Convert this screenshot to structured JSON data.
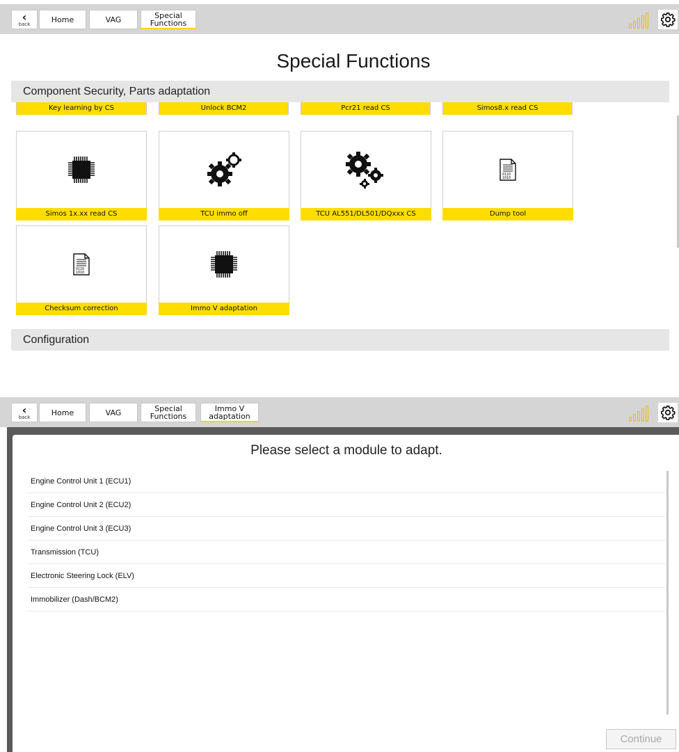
{
  "top": {
    "toolbar": {
      "back_label": "back",
      "crumbs": [
        "Home",
        "VAG",
        "Special Functions"
      ]
    },
    "title": "Special Functions",
    "section1": "Component Security, Parts adaptation",
    "strip_labels": [
      "Key learning by CS",
      "Unlock BCM2",
      "Pcr21 read CS",
      "Simos8.x read CS"
    ],
    "tiles": [
      {
        "label": "Simos 1x.xx read CS",
        "icon": "chip-icon"
      },
      {
        "label": "TCU immo off",
        "icon": "gears-icon"
      },
      {
        "label": "TCU AL551/DL501/DQxxx CS",
        "icon": "gears-icon"
      },
      {
        "label": "Dump tool",
        "icon": "document-icon"
      },
      {
        "label": "Checksum correction",
        "icon": "document-icon"
      },
      {
        "label": "Immo V adaptation",
        "icon": "chip-icon"
      }
    ],
    "section2": "Configuration"
  },
  "bottom": {
    "toolbar": {
      "back_label": "back",
      "crumbs": [
        "Home",
        "VAG",
        "Special Functions",
        "Immo V adaptation"
      ]
    },
    "title": "Please select a module to adapt.",
    "modules": [
      "Engine Control Unit 1 (ECU1)",
      "Engine Control Unit 2 (ECU2)",
      "Engine Control Unit 3 (ECU3)",
      "Transmission (TCU)",
      "Electronic Steering Lock (ELV)",
      "Immobilizer (Dash/BCM2)"
    ],
    "continue_label": "Continue"
  },
  "colors": {
    "accent": "#ffdd00",
    "signal": "#f2b800",
    "toolbar": "#d5d5d5"
  }
}
